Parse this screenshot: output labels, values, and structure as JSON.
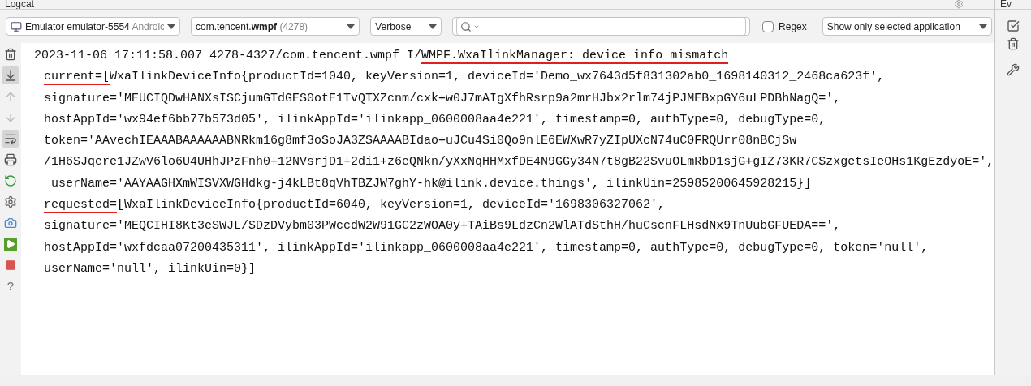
{
  "panel": {
    "title": "Logcat"
  },
  "side_panel": {
    "title": "Ev"
  },
  "toolbar": {
    "device": {
      "name": "Emulator emulator-5554",
      "detail": "Androic"
    },
    "process": {
      "name": "com.tencent.**wmpf**",
      "pid": "(4278)"
    },
    "level": "Verbose",
    "search": {
      "kind": "text"
    },
    "regex": {
      "label": "Regex",
      "checked": false
    },
    "filter": "Show only selected application"
  },
  "side_tools": [
    {
      "kind": "trash",
      "selected": false
    },
    {
      "kind": "scroll-end",
      "selected": true
    },
    {
      "kind": "up",
      "selected": false
    },
    {
      "kind": "down",
      "selected": false
    },
    {
      "kind": "wrap",
      "selected": true
    },
    {
      "kind": "print",
      "selected": false
    },
    {
      "kind": "restart",
      "selected": false
    },
    {
      "kind": "settings",
      "selected": false
    },
    {
      "kind": "camera",
      "selected": false
    },
    {
      "kind": "record",
      "selected": false
    },
    {
      "kind": "stop",
      "selected": false
    },
    {
      "kind": "help",
      "label": "?",
      "selected": false
    }
  ],
  "log_lines": [
    {
      "kind": "header",
      "segments": [
        {
          "text": "2023-11-06 17:11:58.007 4278-4327/com.tencent.wmpf I/",
          "underlined": false
        },
        {
          "text": "WMPF.WxaIlinkManager: device info mismatch",
          "underlined": true
        }
      ]
    },
    {
      "kind": "continuation",
      "segments": [
        {
          "text": "current=[",
          "underlined": true
        },
        {
          "text": "WxaIlinkDeviceInfo{productId=1040, keyVersion=1, deviceId='Demo_wx7643d5f831302ab0_1698140312_2468ca623f',",
          "underlined": false
        }
      ]
    },
    {
      "kind": "continuation",
      "segments": [
        {
          "text": "signature='MEUCIQDwHANXsISCjumGTdGES0otE1TvQTXZcnm/cxk+w0J7mAIgXfhRsrp9a2mrHJbx2rlm74jPJMEBxpGY6uLPDBhNagQ=',",
          "underlined": false
        }
      ]
    },
    {
      "kind": "continuation",
      "segments": [
        {
          "text": "hostAppId='wx94ef6bb77b573d05', ilinkAppId='ilinkapp_0600008aa4e221', timestamp=0, authType=0, debugType=0,",
          "underlined": false
        }
      ]
    },
    {
      "kind": "continuation",
      "segments": [
        {
          "text": "token='AAvechIEAAABAAAAAABNRkm16g8mf3oSoJA3ZSAAAABIdao+uJCu4Si0Qo9nlE6EWXwR7yZIpUXcN74uC0FRQUrr08nBCjSw",
          "underlined": false
        }
      ]
    },
    {
      "kind": "continuation",
      "segments": [
        {
          "text": "/1H6SJqere1JZwV6lo6U4UHhJPzFnh0+12NVsrjD1+2di1+z6eQNkn/yXxNqHHMxfDE4N9GGy34N7t8gB22SvuOLmRbD1sjG+gIZ73KR7CSzxgetsIeOHs1KgEzdyoE=',",
          "underlined": false
        }
      ]
    },
    {
      "kind": "continuation",
      "segments": [
        {
          "text": " userName='AAYAAGHXmWISVXWGHdkg-j4kLBt8qVhTBZJW7ghY-hk@ilink.device.things', ilinkUin=25985200645928215}]",
          "underlined": false
        }
      ]
    },
    {
      "kind": "continuation",
      "segments": [
        {
          "text": "requested=",
          "underlined": true
        },
        {
          "text": "[WxaIlinkDeviceInfo{productId=6040, keyVersion=1, deviceId='1698306327062',",
          "underlined": false
        }
      ]
    },
    {
      "kind": "continuation",
      "segments": [
        {
          "text": "signature='MEQCIHI8Kt3eSWJL/SDzDVybm03PWccdW2W91GC2zWOA0y+TAiBs9LdzCn2WlATdSthH/huCscnFLHsdNx9TnUubGFUEDA==',",
          "underlined": false
        }
      ]
    },
    {
      "kind": "continuation",
      "segments": [
        {
          "text": "hostAppId='wxfdcaa07200435311', ilinkAppId='ilinkapp_0600008aa4e221', timestamp=0, authType=0, debugType=0, token='null',",
          "underlined": false
        }
      ]
    },
    {
      "kind": "continuation",
      "segments": [
        {
          "text": "userName='null', ilinkUin=0}]",
          "underlined": false
        }
      ]
    }
  ]
}
